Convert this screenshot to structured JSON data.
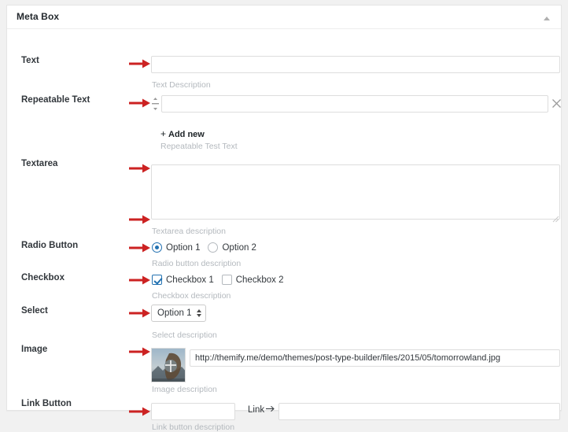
{
  "panel": {
    "title": "Meta Box",
    "collapse_icon": "chevron-up-icon"
  },
  "accent": {
    "arrow_red": "#cc2222",
    "link_blue": "#2271b1",
    "desc_gray": "#b4b9be",
    "label_dark": "#32373c",
    "border_gray": "#dddddd"
  },
  "fields": [
    {
      "label": "Text",
      "type": "text",
      "value": "",
      "placeholder": "",
      "description": "Text Description"
    },
    {
      "label": "Repeatable Text",
      "type": "repeatable-text",
      "value": "",
      "placeholder": "",
      "add_new_label": "Add new",
      "add_new_plus": "+",
      "drag_handle_icon": "drag-handle-icon",
      "delete_icon": "close-x-icon",
      "description": "Repeatable Test Text"
    },
    {
      "label": "Textarea",
      "type": "textarea",
      "value": "",
      "placeholder": "",
      "description": "Textarea description"
    },
    {
      "label": "Radio Button",
      "type": "radio",
      "options": [
        {
          "label": "Option 1",
          "checked": true
        },
        {
          "label": "Option 2",
          "checked": false
        }
      ],
      "description": "Radio button description"
    },
    {
      "label": "Checkbox",
      "type": "checkbox",
      "options": [
        {
          "label": "Checkbox 1",
          "checked": true
        },
        {
          "label": "Checkbox 2",
          "checked": false
        }
      ],
      "description": "Checkbox description"
    },
    {
      "label": "Select",
      "type": "select",
      "value": "Option 1",
      "options": [
        "Option 1"
      ],
      "description": "Select description"
    },
    {
      "label": "Image",
      "type": "image",
      "value": "http://themify.me/demo/themes/post-type-builder/files/2015/05/tomorrowland.jpg",
      "thumbnail_alt": "tomorrowland-thumbnail",
      "description": "Image description"
    },
    {
      "label": "Link Button",
      "type": "link-button",
      "button_text_value": "",
      "link_label": "Link",
      "link_value": "",
      "description": "Link button description"
    }
  ]
}
